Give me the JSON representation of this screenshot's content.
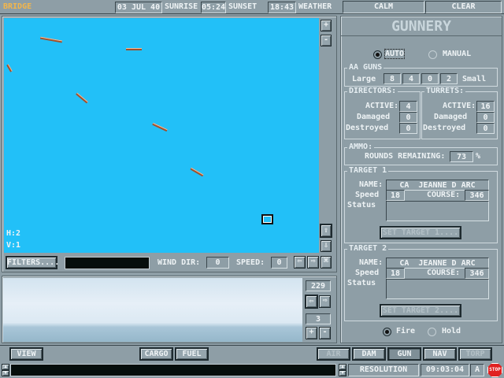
{
  "topbar": {
    "title": "BRIDGE",
    "date": "03 JUL 40",
    "sunrise_label": "SUNRISE",
    "sunrise": "05:24",
    "sunset_label": "SUNSET",
    "sunset": "18:43",
    "weather_label": "WEATHER",
    "wind": "CALM",
    "sky": "CLEAR"
  },
  "map": {
    "h": "H:2",
    "v": "V:1",
    "filters": "FILTERS....",
    "wind_dir_label": "WIND DIR:",
    "wind_dir": "0",
    "speed_label": "SPEED:",
    "speed": "0",
    "sea_color": "#22c0f8"
  },
  "view": {
    "bearing": "229",
    "zoom": "3",
    "plus": "+",
    "minus": "-"
  },
  "gunnery": {
    "title": "GUNNERY",
    "auto": "AUTO",
    "manual": "MANUAL",
    "mode": "auto",
    "aa": {
      "title": "AA GUNS",
      "large": "Large",
      "small": "Small",
      "values": [
        "8",
        "4",
        "0",
        "2"
      ]
    },
    "directors": {
      "title": "DIRECTORS:",
      "active_label": "ACTIVE:",
      "active": "4",
      "damaged_label": "Damaged",
      "damaged": "0",
      "destroyed_label": "Destroyed",
      "destroyed": "0"
    },
    "turrets": {
      "title": "TURRETS:",
      "active_label": "ACTIVE:",
      "active": "16",
      "damaged_label": "Damaged",
      "damaged": "0",
      "destroyed_label": "Destroyed",
      "destroyed": "0"
    },
    "ammo": {
      "title": "AMMO:",
      "label": "ROUNDS REMAINING:",
      "value": "73",
      "unit": "%"
    },
    "target1": {
      "title": "TARGET 1",
      "name_label": "NAME:",
      "name": "CA  JEANNE D ARC",
      "speed_label": "Speed",
      "speed": "18",
      "course_label": "COURSE:",
      "course": "346",
      "status_label": "Status",
      "button": "SET TARGET 1...."
    },
    "target2": {
      "title": "TARGET 2",
      "name_label": "NAME:",
      "name": "CA  JEANNE D ARC",
      "speed_label": "Speed",
      "speed": "18",
      "course_label": "COURSE:",
      "course": "346",
      "status_label": "Status",
      "button": "SET TARGET 2...."
    },
    "fire": "Fire",
    "hold": "Hold",
    "fire_mode": "fire"
  },
  "bottom": {
    "view": "VIEW",
    "cargo": "CARGO",
    "fuel": "FUEL",
    "tabs": [
      "AIR",
      "DAM",
      "GUN",
      "NAV",
      "TORP"
    ],
    "active_tab": "GUN"
  },
  "status": {
    "resolution": "RESOLUTION",
    "time": "09:03:04",
    "mode": "A",
    "stop": "STOP"
  }
}
